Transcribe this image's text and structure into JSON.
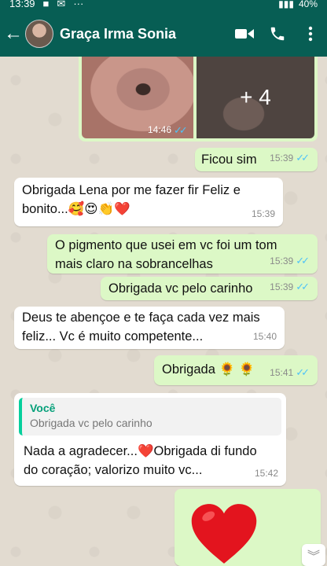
{
  "statusbar": {
    "time": "13:39",
    "battery": "40%",
    "notif_more": "···"
  },
  "appbar": {
    "contact_name": "Graça Irma Sonia"
  },
  "media": {
    "more_count": "+ 4",
    "time": "14:46"
  },
  "messages": [
    {
      "id": "m1",
      "direction": "out",
      "text": "Ficou sim",
      "time": "15:39",
      "read": true
    },
    {
      "id": "m2",
      "direction": "in",
      "line1": "Obrigada Lena por me fazer fir Feliz e",
      "line2": "bonito...",
      "emoji": "🥰😍👏",
      "heart": "❤️",
      "time": "15:39"
    },
    {
      "id": "m3",
      "direction": "out",
      "line1": "O pigmento que usei em vc foi um tom",
      "line2": "mais claro na sobrancelhas",
      "time": "15:39",
      "read": true
    },
    {
      "id": "m4",
      "direction": "out",
      "text": "Obrigada vc pelo carinho",
      "time": "15:39",
      "read": true
    },
    {
      "id": "m5",
      "direction": "in",
      "line1": "Deus  te abençoe e te faça cada vez mais",
      "line2": "feliz... Vc é muito competente...",
      "time": "15:40"
    },
    {
      "id": "m6",
      "direction": "out",
      "text": "Obrigada",
      "emoji": "🌻 🌻",
      "time": "15:41",
      "read": true
    },
    {
      "id": "m7",
      "direction": "in",
      "quote_author": "Você",
      "quote_text": "Obrigada vc pelo carinho",
      "line1a": "Nada a agradecer...",
      "heart": "❤️",
      "line1b": "Obrigada di fundo",
      "line2": "do coração;  valorizo muito vc...",
      "time": "15:42"
    },
    {
      "id": "m8",
      "direction": "out",
      "big_heart": "❤️"
    }
  ],
  "colors": {
    "header": "#075e54",
    "outgoing": "#dcf8c6",
    "incoming": "#ffffff",
    "ticks": "#4fc3f7"
  }
}
